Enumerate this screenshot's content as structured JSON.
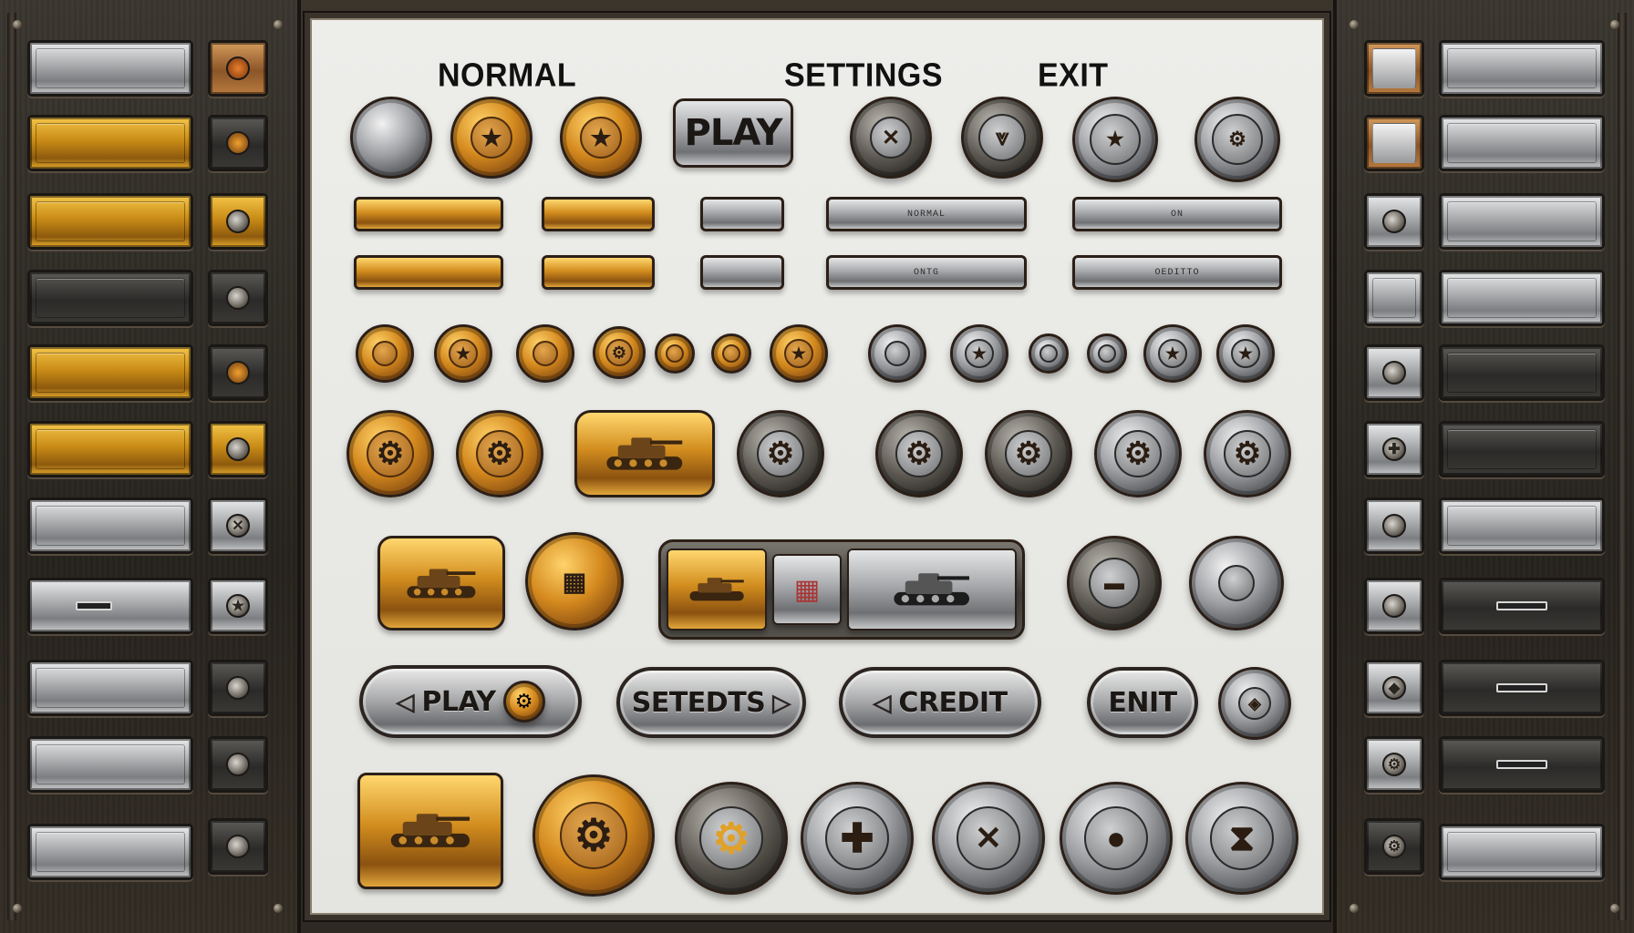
{
  "headings": {
    "normal": "NORMAL",
    "settings": "SETTINGS",
    "exit": "EXIT"
  },
  "row1": {
    "play_plate": "PLAY"
  },
  "plates": {
    "small_1": "NORMAL",
    "small_2": "ON",
    "small_3": "ONTG",
    "small_4": "OEDITTO"
  },
  "pills": {
    "play": "PLAY",
    "setedts": "SETEDTS",
    "credit": "CREDIT",
    "enit": "ENIT"
  },
  "icons": {
    "star": "★",
    "gear": "⚙",
    "cross": "✚",
    "arrow_left": "◁",
    "arrow_right": "▷",
    "x_mark": "✕",
    "hourglass": "⧗",
    "dot": "●"
  },
  "colors": {
    "gold": "#d4891e",
    "steel": "#9d9fa3",
    "dark": "#3a3936",
    "panel": "#ededea",
    "frame": "#2a2622"
  }
}
